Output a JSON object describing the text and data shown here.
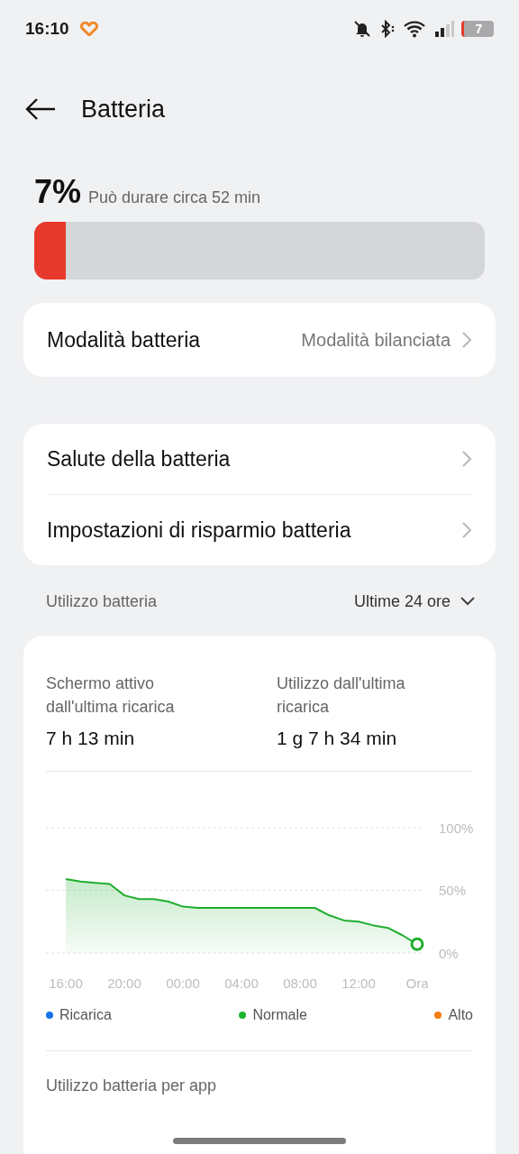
{
  "status_bar": {
    "time": "16:10",
    "battery": "7"
  },
  "header": {
    "title": "Batteria"
  },
  "battery": {
    "percent": "7%",
    "estimate": "Può durare circa 52 min",
    "level": 0.07
  },
  "mode_card": {
    "label": "Modalità batteria",
    "value": "Modalità bilanciata"
  },
  "settings": [
    {
      "label": "Salute della batteria"
    },
    {
      "label": "Impostazioni di risparmio batteria"
    }
  ],
  "usage": {
    "title": "Utilizzo batteria",
    "range": "Ultime 24 ore",
    "stats": [
      {
        "label": "Schermo attivo dall'ultima ricarica",
        "value": "7 h 13 min"
      },
      {
        "label": "Utilizzo dall'ultima ricarica",
        "value": "1 g 7 h 34 min"
      }
    ],
    "chart_data": {
      "type": "area",
      "categories": [
        "16:00",
        null,
        null,
        null,
        "20:00",
        null,
        null,
        null,
        "00:00",
        null,
        null,
        null,
        "04:00",
        null,
        null,
        null,
        "08:00",
        null,
        null,
        null,
        "12:00",
        null,
        null,
        null,
        "Ora"
      ],
      "series": [
        {
          "color": "#1fae2f",
          "values": [
            59,
            57,
            56,
            55,
            46,
            43,
            43,
            41,
            37,
            36,
            36,
            36,
            36,
            36,
            36,
            36,
            36,
            36,
            30,
            26,
            25,
            22,
            20,
            14,
            7
          ]
        }
      ],
      "ylim": [
        0,
        100
      ],
      "yticks": [
        {
          "value": 100,
          "label": "100%"
        },
        {
          "value": 50,
          "label": "50%"
        },
        {
          "value": 0,
          "label": "0%"
        }
      ]
    },
    "legend": [
      {
        "label": "Ricarica",
        "color": "#1a73e8"
      },
      {
        "label": "Normale",
        "color": "#1fb52f"
      },
      {
        "label": "Alto",
        "color": "#f57c10"
      }
    ],
    "per_app_title": "Utilizzo batteria per app"
  }
}
